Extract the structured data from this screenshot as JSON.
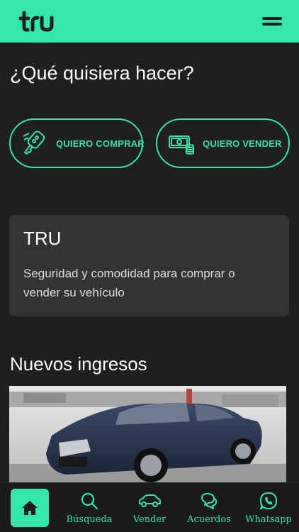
{
  "header": {
    "logo_text": "tru",
    "menu_icon": "menu-icon"
  },
  "question": "¿Qué quisiera hacer?",
  "actions": {
    "buy_label": "QUIERO COMPRAR",
    "sell_label": "QUIERO VENDER",
    "buy_icon": "car-key-icon",
    "sell_icon": "money-icon"
  },
  "info_card": {
    "title": "TRU",
    "description": "Seguridad y comodidad para comprar o vender su vehículo"
  },
  "new_arrivals": {
    "title": "Nuevos ingresos"
  },
  "nav": {
    "home_icon": "home-icon",
    "items": [
      {
        "label": "Búsqueda",
        "icon": "search-icon"
      },
      {
        "label": "Vender",
        "icon": "car-icon"
      },
      {
        "label": "Acuerdos",
        "icon": "chat-bubbles-icon"
      },
      {
        "label": "Whatsapp",
        "icon": "whatsapp-icon"
      }
    ]
  },
  "colors": {
    "accent": "#33e6ab",
    "background": "#1f1f1f",
    "card": "#333333"
  }
}
